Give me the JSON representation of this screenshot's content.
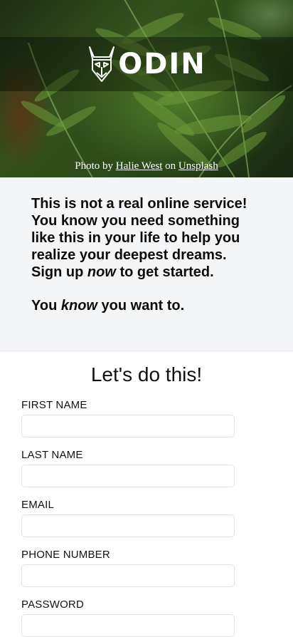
{
  "hero": {
    "logo_text": "ODIN",
    "credit_prefix": "Photo by",
    "photographer": "Halie West",
    "credit_middle": "on",
    "source": "Unsplash"
  },
  "pitch": {
    "line1": "This is not a real online service! You know you need something like this in your life to help you realize your deepest dreams.",
    "line2_start": "Sign up",
    "line2_em": "now",
    "line2_end": "to get started.",
    "line3_start": "You",
    "line3_em": "know",
    "line3_end": "you want to."
  },
  "form": {
    "title": "Let's do this!",
    "fields": [
      {
        "label": "FIRST NAME",
        "value": "",
        "placeholder": ""
      },
      {
        "label": "LAST NAME",
        "value": "",
        "placeholder": ""
      },
      {
        "label": "EMAIL",
        "value": "",
        "placeholder": ""
      },
      {
        "label": "PHONE NUMBER",
        "value": "",
        "placeholder": ""
      },
      {
        "label": "PASSWORD",
        "value": "",
        "placeholder": ""
      }
    ]
  }
}
